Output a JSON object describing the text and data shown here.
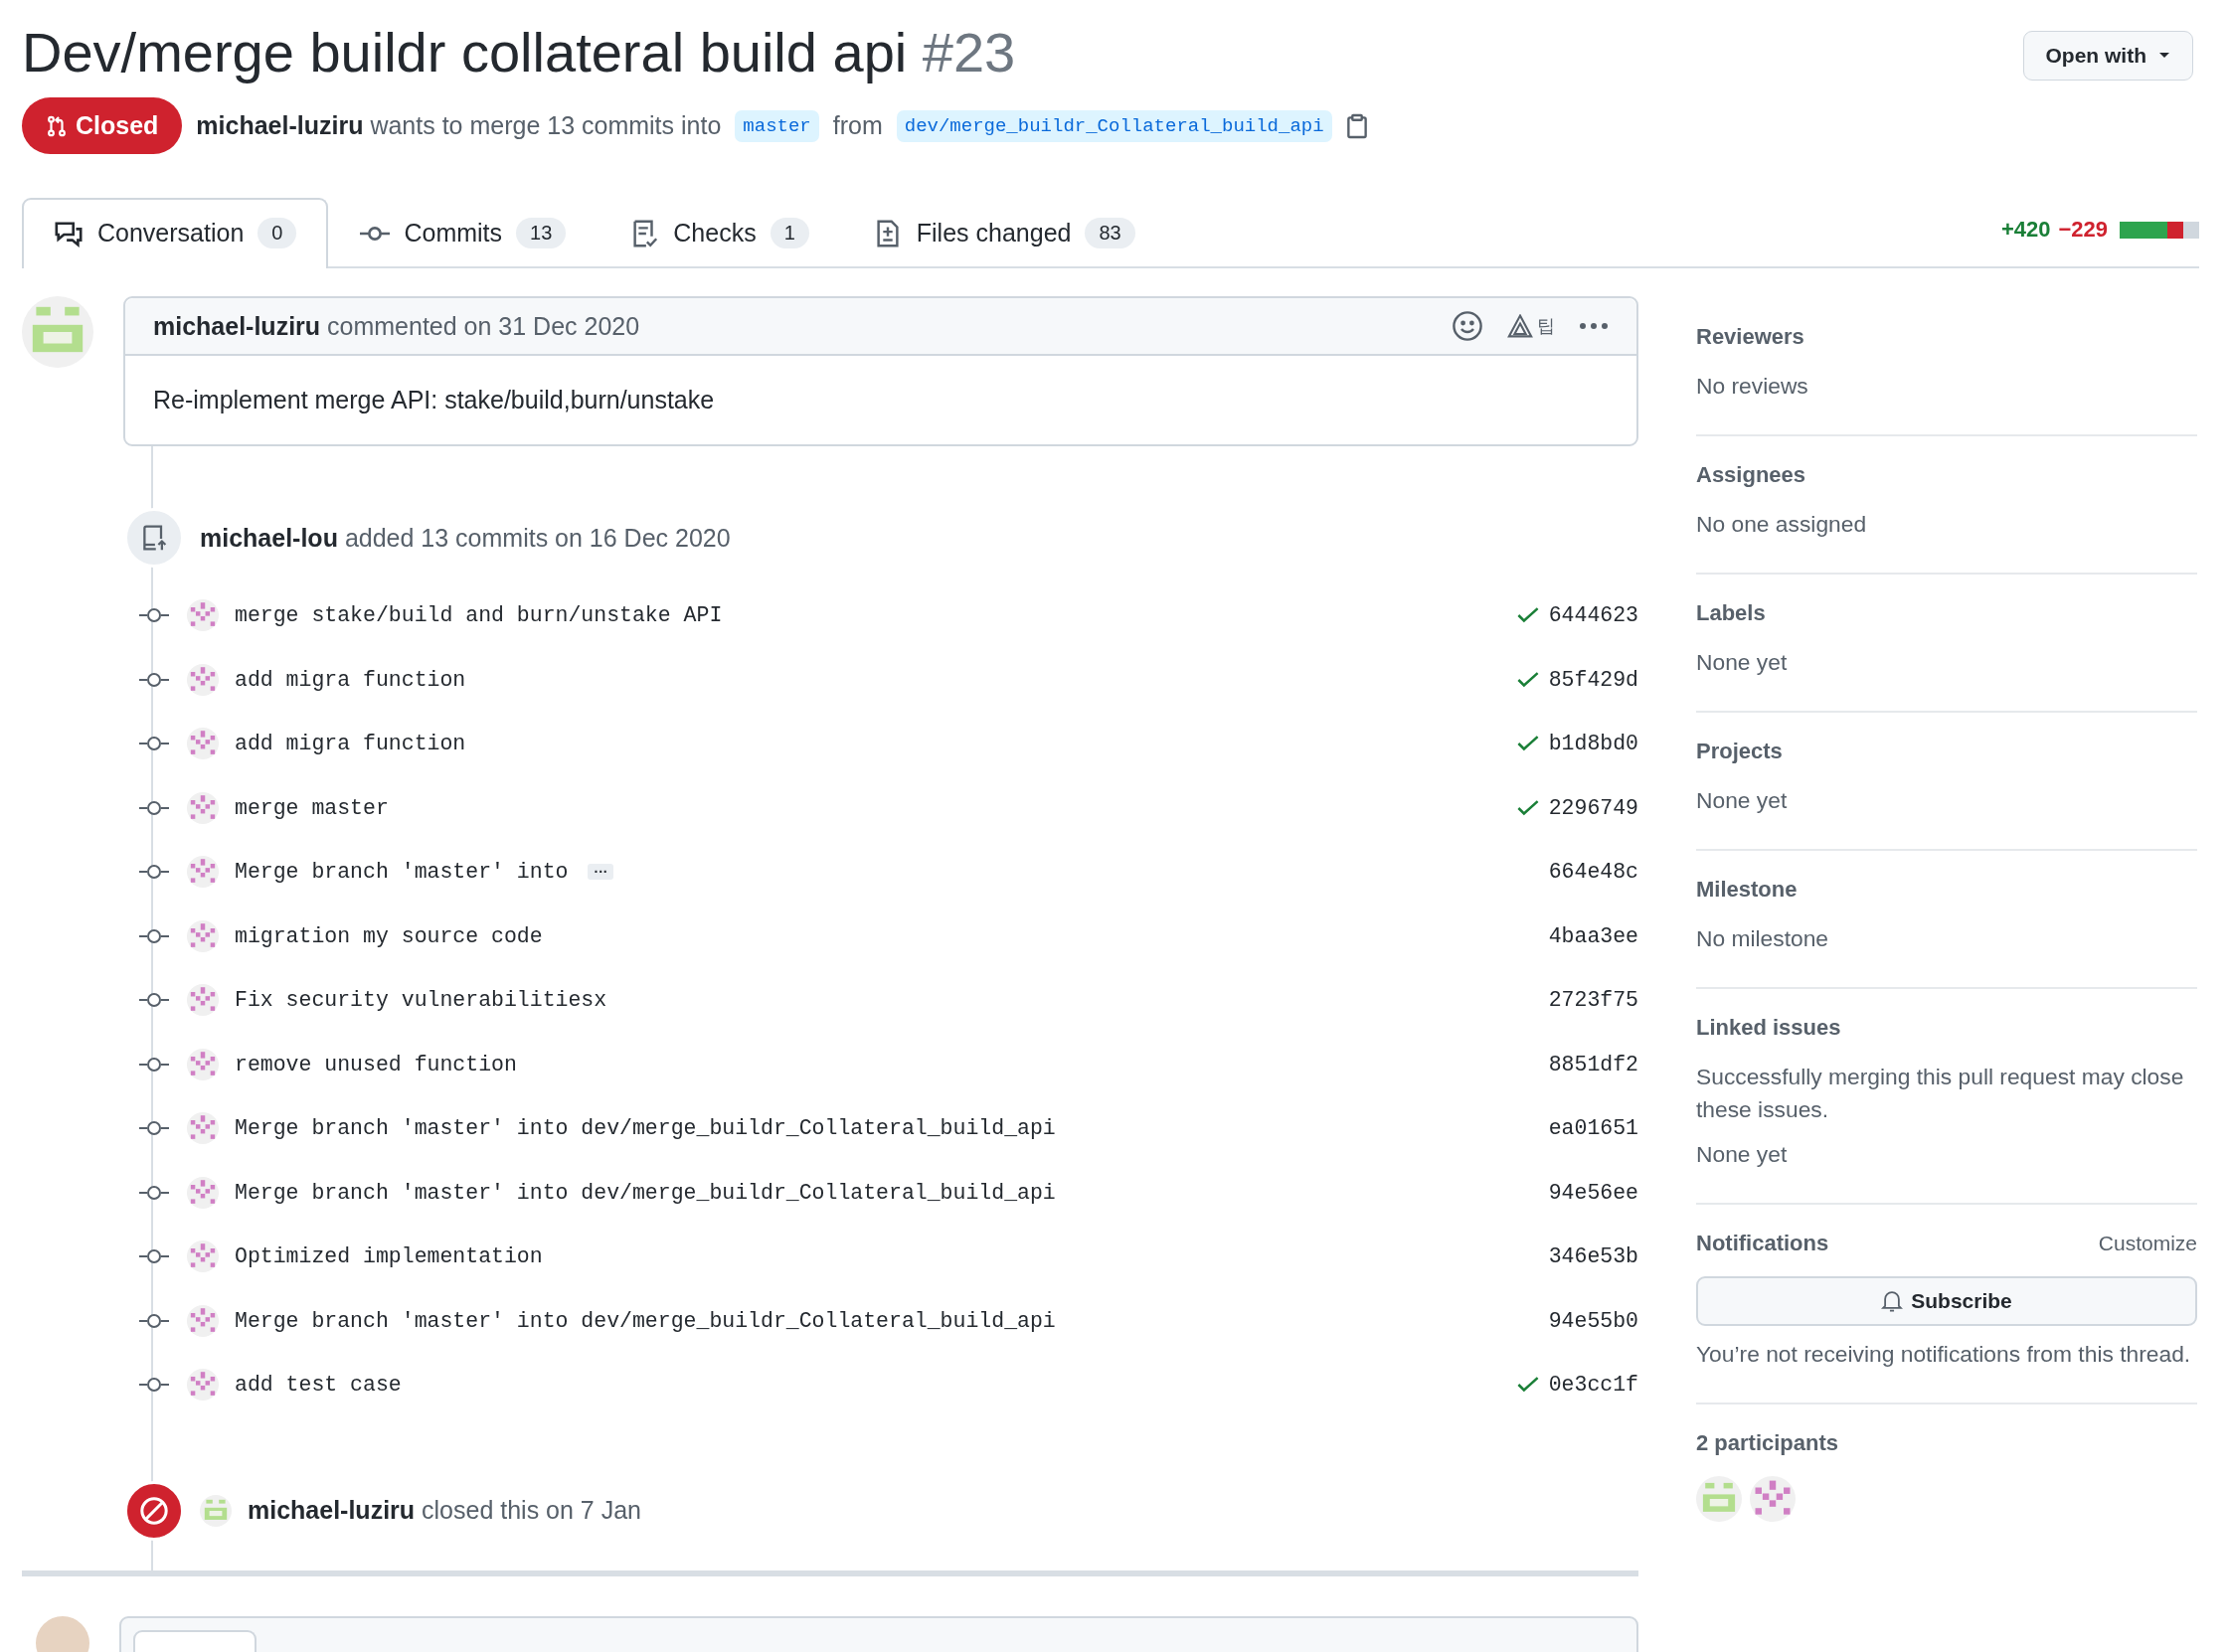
{
  "header": {
    "title": "Dev/merge buildr collateral build api",
    "number": "#23",
    "open_with": "Open with",
    "state": {
      "label": "Closed",
      "kind": "closed"
    },
    "author": "michael-luziru",
    "summary": "wants to merge 13 commits into",
    "base": "master",
    "from": "from",
    "head": "dev/merge_buildr_Collateral_build_api"
  },
  "tabs": [
    {
      "label": "Conversation",
      "count": "0",
      "selected": true,
      "kind": "conversation"
    },
    {
      "label": "Commits",
      "count": "13",
      "selected": false,
      "kind": "commit"
    },
    {
      "label": "Checks",
      "count": "1",
      "selected": false,
      "kind": "checks"
    },
    {
      "label": "Files changed",
      "count": "83",
      "selected": false,
      "kind": "file"
    }
  ],
  "diffstat": {
    "added": "+420",
    "deleted": "−229",
    "blocks": [
      {
        "kind": "added"
      },
      {
        "kind": "added"
      },
      {
        "kind": "added"
      },
      {
        "kind": "deleted"
      },
      {
        "kind": "neutral"
      }
    ]
  },
  "comment": {
    "author": "michael-luziru",
    "action": "commented on 31 Dec 2020",
    "tip": "팁",
    "body": "Re-implement merge API: stake/build,burn/unstake"
  },
  "commit_event": {
    "author": "michael-lou",
    "action": "added 13 commits on 16 Dec 2020"
  },
  "commits": [
    {
      "message": "merge stake/build and burn/unstake API",
      "sha": "6444623",
      "verified": true
    },
    {
      "message": "add migra function",
      "sha": "85f429d",
      "verified": true
    },
    {
      "message": "add migra function",
      "sha": "b1d8bd0",
      "verified": true
    },
    {
      "message": "merge master",
      "sha": "2296749",
      "verified": true
    },
    {
      "message": "Merge branch 'master' into",
      "expander": "···",
      "sha": "664e48c",
      "verified": false
    },
    {
      "message": "migration my source code",
      "sha": "4baa3ee",
      "verified": false
    },
    {
      "message": "Fix security vulnerabilitiesx",
      "sha": "2723f75",
      "verified": false
    },
    {
      "message": "remove unused function",
      "sha": "8851df2",
      "verified": false
    },
    {
      "message": "Merge branch 'master' into dev/merge_buildr_Collateral_build_api",
      "sha": "ea01651",
      "verified": false
    },
    {
      "message": "Merge branch 'master' into dev/merge_buildr_Collateral_build_api",
      "sha": "94e56ee",
      "verified": false
    },
    {
      "message": "Optimized implementation",
      "sha": "346e53b",
      "verified": false
    },
    {
      "message": "Merge branch 'master' into dev/merge_buildr_Collateral_build_api",
      "sha": "94e55b0",
      "verified": false
    },
    {
      "message": "add test case",
      "sha": "0e3cc1f",
      "verified": true
    }
  ],
  "close_event": {
    "author": "michael-luziru",
    "action": "closed this on 7 Jan"
  },
  "sidebar": {
    "sections": [
      {
        "heading": "Reviewers",
        "lines": [
          "No reviews"
        ]
      },
      {
        "heading": "Assignees",
        "lines": [
          "No one assigned"
        ]
      },
      {
        "heading": "Labels",
        "lines": [
          "None yet"
        ]
      },
      {
        "heading": "Projects",
        "lines": [
          "None yet"
        ]
      },
      {
        "heading": "Milestone",
        "lines": [
          "No milestone"
        ]
      },
      {
        "heading": "Linked issues",
        "lines": [
          "Successfully merging this pull request may close these issues.",
          "None yet"
        ]
      }
    ],
    "notifications": {
      "heading": "Notifications",
      "customize": "Customize",
      "button": "Subscribe",
      "note": "You’re not receiving notifications from this thread."
    },
    "participants": {
      "heading": "2 participants",
      "avatars": [
        {
          "kind": "bars"
        },
        {
          "kind": "checker"
        }
      ]
    }
  }
}
